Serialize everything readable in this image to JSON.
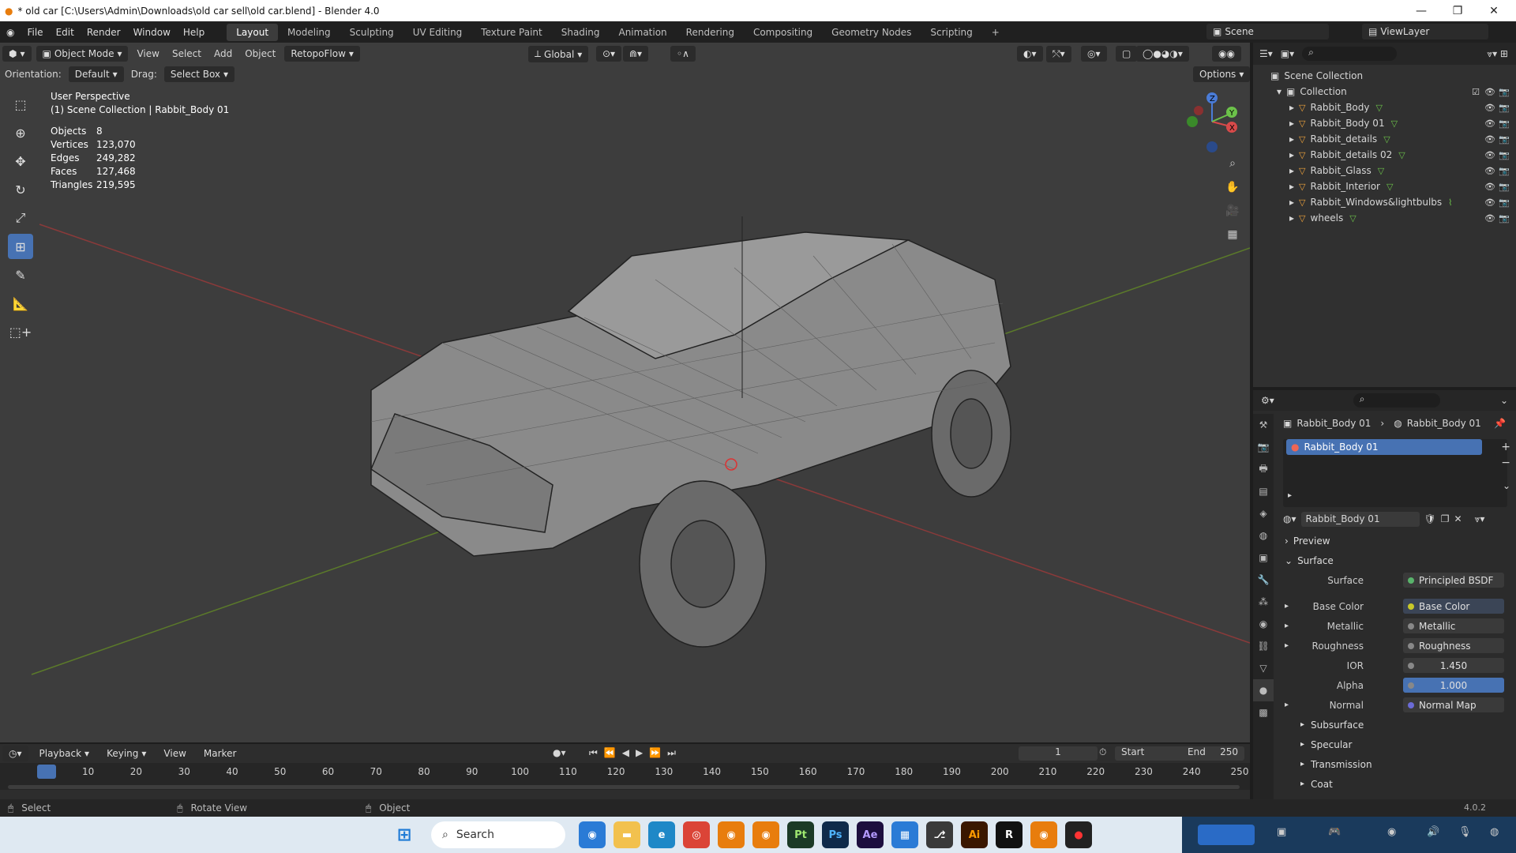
{
  "title": {
    "text": "* old car [C:\\Users\\Admin\\Downloads\\old car sell\\old car.blend] - Blender 4.0"
  },
  "menus": [
    "File",
    "Edit",
    "Render",
    "Window",
    "Help"
  ],
  "workspaces": [
    "Layout",
    "Modeling",
    "Sculpting",
    "UV Editing",
    "Texture Paint",
    "Shading",
    "Animation",
    "Rendering",
    "Compositing",
    "Geometry Nodes",
    "Scripting"
  ],
  "scene": "Scene",
  "viewlayer": "ViewLayer",
  "vp": {
    "mode": "Object Mode",
    "view": "View",
    "select": "Select",
    "add": "Add",
    "object": "Object",
    "retopo": "RetopoFlow",
    "orient": "Global",
    "orientation_label": "Orientation:",
    "orientation_val": "Default",
    "drag_label": "Drag:",
    "drag_val": "Select Box",
    "options": "Options"
  },
  "stats": {
    "persp": "User Perspective",
    "coll": "(1) Scene Collection | Rabbit_Body 01",
    "rows": [
      {
        "k": "Objects",
        "v": "8"
      },
      {
        "k": "Vertices",
        "v": "123,070"
      },
      {
        "k": "Edges",
        "v": "249,282"
      },
      {
        "k": "Faces",
        "v": "127,468"
      },
      {
        "k": "Triangles",
        "v": "219,595"
      }
    ]
  },
  "outliner": {
    "scene_collection": "Scene Collection",
    "collection": "Collection",
    "items": [
      "Rabbit_Body",
      "Rabbit_Body 01",
      "Rabbit_details",
      "Rabbit_details 02",
      "Rabbit_Glass",
      "Rabbit_Interior",
      "Rabbit_Windows&lightbulbs",
      "wheels"
    ]
  },
  "props": {
    "crumb1": "Rabbit_Body 01",
    "crumb2": "Rabbit_Body 01",
    "slot": "Rabbit_Body 01",
    "material": "Rabbit_Body 01",
    "preview": "Preview",
    "surface_sec": "Surface",
    "fields": [
      {
        "k": "Surface",
        "v": "Principled BSDF"
      },
      {
        "k": "Base Color",
        "v": "Base Color"
      },
      {
        "k": "Metallic",
        "v": "Metallic"
      },
      {
        "k": "Roughness",
        "v": "Roughness"
      },
      {
        "k": "IOR",
        "v": "1.450"
      },
      {
        "k": "Alpha",
        "v": "1.000"
      },
      {
        "k": "Normal",
        "v": "Normal Map"
      }
    ],
    "sections": [
      "Subsurface",
      "Specular",
      "Transmission",
      "Coat"
    ]
  },
  "timeline": {
    "playback": "Playback",
    "keying": "Keying",
    "view": "View",
    "marker": "Marker",
    "frame": "1",
    "start_label": "Start",
    "start": "1",
    "end_label": "End",
    "end": "250",
    "ticks": [
      "1",
      "10",
      "20",
      "30",
      "40",
      "50",
      "60",
      "70",
      "80",
      "90",
      "100",
      "110",
      "120",
      "130",
      "140",
      "150",
      "160",
      "170",
      "180",
      "190",
      "200",
      "210",
      "220",
      "230",
      "240",
      "250"
    ]
  },
  "status": {
    "select": "Select",
    "rotate": "Rotate View",
    "object": "Object",
    "version": "4.0.2"
  },
  "taskbar": {
    "search": "Search"
  },
  "axis_letters": {
    "x": "X",
    "y": "Y",
    "z": "Z"
  }
}
